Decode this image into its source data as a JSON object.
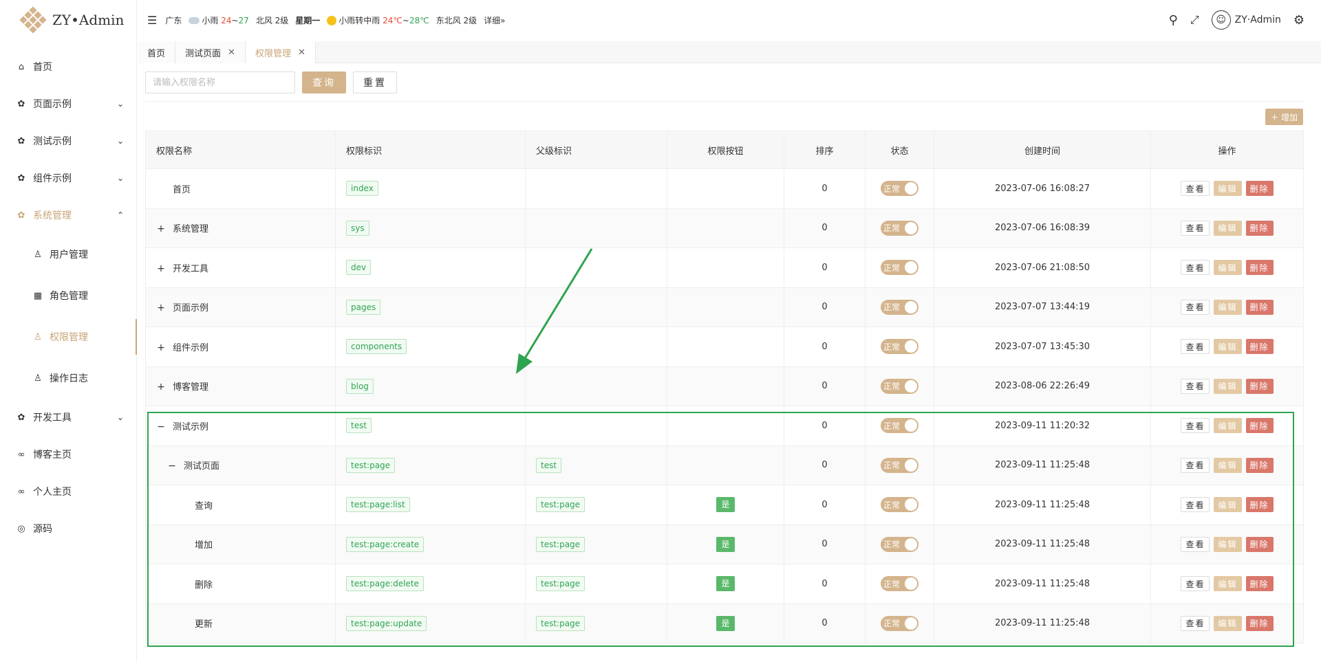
{
  "app": {
    "title": "ZY•Admin"
  },
  "sidebar": {
    "items": [
      {
        "label": "首页",
        "icon": "home-icon"
      },
      {
        "label": "页面示例",
        "icon": "gear-icon",
        "chevron": "chevron-down-icon"
      },
      {
        "label": "测试示例",
        "icon": "gear-icon",
        "chevron": "chevron-down-icon"
      },
      {
        "label": "组件示例",
        "icon": "gear-icon",
        "chevron": "chevron-down-icon"
      },
      {
        "label": "系统管理",
        "icon": "gear-icon",
        "chevron": "chevron-up-icon",
        "state": "open"
      },
      {
        "label": "用户管理",
        "icon": "user-icon",
        "sub": true
      },
      {
        "label": "角色管理",
        "icon": "grid-icon",
        "sub": true
      },
      {
        "label": "权限管理",
        "icon": "user-icon",
        "sub": true,
        "state": "active"
      },
      {
        "label": "操作日志",
        "icon": "user-icon",
        "sub": true
      },
      {
        "label": "开发工具",
        "icon": "gear-icon",
        "chevron": "chevron-down-icon"
      },
      {
        "label": "博客主页",
        "icon": "link-icon"
      },
      {
        "label": "个人主页",
        "icon": "link-icon"
      },
      {
        "label": "源码",
        "icon": "github-icon"
      }
    ]
  },
  "header": {
    "location": "广东",
    "today_weather": "小雨",
    "today_low": "24",
    "temp_sep": "~",
    "today_high": "27",
    "today_wind": "北风 2级",
    "weekday": "星期一",
    "tomorrow_weather": "小雨转中雨",
    "tomorrow_low": "24℃",
    "tomorrow_high": "28℃",
    "tomorrow_wind": "东北风 2级",
    "detail": "详细»",
    "username": "ZY·Admin"
  },
  "tabs": [
    {
      "label": "首页",
      "closable": false,
      "active": false
    },
    {
      "label": "测试页面",
      "closable": true,
      "active": false
    },
    {
      "label": "权限管理",
      "closable": true,
      "active": true
    }
  ],
  "search": {
    "placeholder": "请输入权限名称",
    "query_label": "查询",
    "reset_label": "重置",
    "add_label": "＋ 增加"
  },
  "table": {
    "columns": [
      "权限名称",
      "权限标识",
      "父级标识",
      "权限按钮",
      "排序",
      "状态",
      "创建时间",
      "操作"
    ],
    "status_label": "正常",
    "view_label": "查看",
    "edit_label": "编辑",
    "delete_label": "删除",
    "rows": [
      {
        "name": "首页",
        "expander": "",
        "level": 0,
        "code": "index",
        "parent": "",
        "is_button": "",
        "sort": "0",
        "created": "2023-07-06 16:08:27"
      },
      {
        "name": "系统管理",
        "expander": "+",
        "level": 0,
        "code": "sys",
        "parent": "",
        "is_button": "",
        "sort": "0",
        "created": "2023-07-06 16:08:39"
      },
      {
        "name": "开发工具",
        "expander": "+",
        "level": 0,
        "code": "dev",
        "parent": "",
        "is_button": "",
        "sort": "0",
        "created": "2023-07-06 21:08:50"
      },
      {
        "name": "页面示例",
        "expander": "+",
        "level": 0,
        "code": "pages",
        "parent": "",
        "is_button": "",
        "sort": "0",
        "created": "2023-07-07 13:44:19"
      },
      {
        "name": "组件示例",
        "expander": "+",
        "level": 0,
        "code": "components",
        "parent": "",
        "is_button": "",
        "sort": "0",
        "created": "2023-07-07 13:45:30"
      },
      {
        "name": "博客管理",
        "expander": "+",
        "level": 0,
        "code": "blog",
        "parent": "",
        "is_button": "",
        "sort": "0",
        "created": "2023-08-06 22:26:49"
      },
      {
        "name": "测试示例",
        "expander": "−",
        "level": 0,
        "code": "test",
        "parent": "",
        "is_button": "",
        "sort": "0",
        "created": "2023-09-11 11:20:32"
      },
      {
        "name": "测试页面",
        "expander": "−",
        "level": 1,
        "code": "test:page",
        "parent": "test",
        "is_button": "",
        "sort": "0",
        "created": "2023-09-11 11:25:48"
      },
      {
        "name": "查询",
        "expander": "",
        "level": 2,
        "code": "test:page:list",
        "parent": "test:page",
        "is_button": "是",
        "sort": "0",
        "created": "2023-09-11 11:25:48"
      },
      {
        "name": "增加",
        "expander": "",
        "level": 2,
        "code": "test:page:create",
        "parent": "test:page",
        "is_button": "是",
        "sort": "0",
        "created": "2023-09-11 11:25:48"
      },
      {
        "name": "删除",
        "expander": "",
        "level": 2,
        "code": "test:page:delete",
        "parent": "test:page",
        "is_button": "是",
        "sort": "0",
        "created": "2023-09-11 11:25:48"
      },
      {
        "name": "更新",
        "expander": "",
        "level": 2,
        "code": "test:page:update",
        "parent": "test:page",
        "is_button": "是",
        "sort": "0",
        "created": "2023-09-11 11:25:48"
      }
    ]
  },
  "colors": {
    "accent": "#d4b48c",
    "annotation": "#2ea44f",
    "tag_green": "#31a355",
    "danger": "#d9776b"
  }
}
